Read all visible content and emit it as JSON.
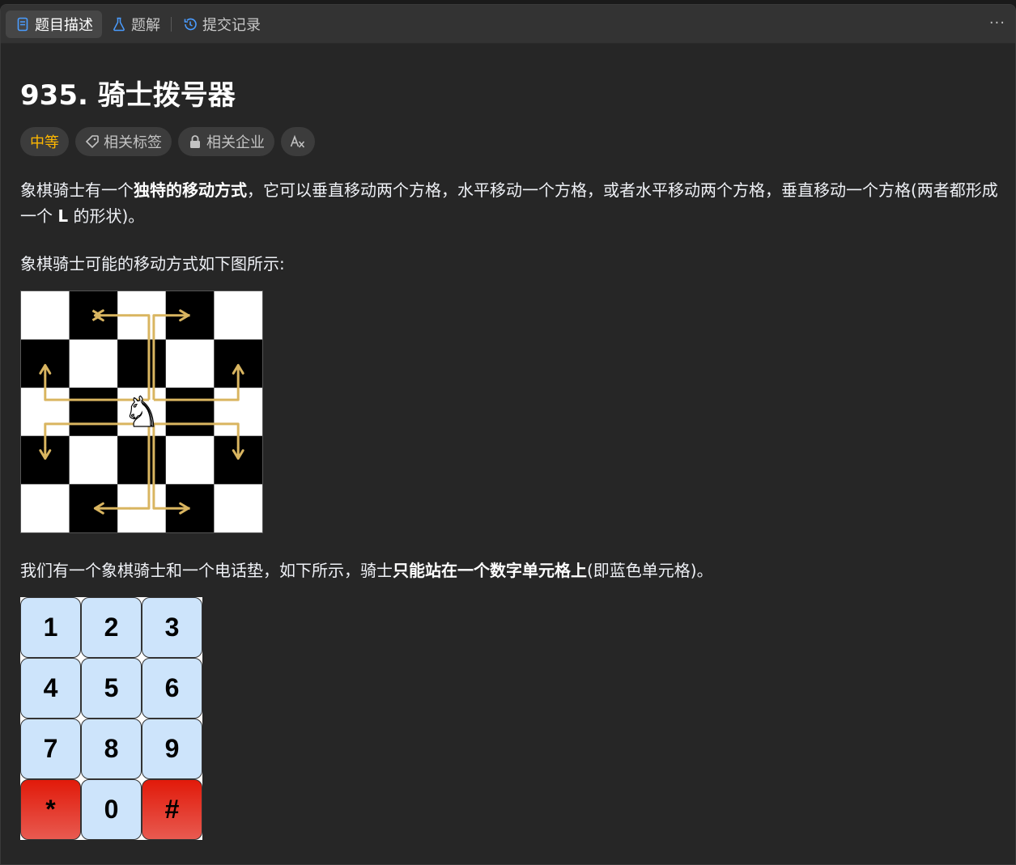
{
  "tabs": [
    {
      "label": "题目描述",
      "icon": "document-icon",
      "active": true
    },
    {
      "label": "题解",
      "icon": "flask-icon",
      "active": false
    },
    {
      "label": "提交记录",
      "icon": "history-icon",
      "active": false
    }
  ],
  "more_label": "···",
  "problem": {
    "title": "935. 骑士拨号器",
    "difficulty": "中等",
    "difficulty_color": "#ffb800",
    "tags": [
      {
        "label": "相关标签",
        "icon": "tag-icon"
      },
      {
        "label": "相关企业",
        "icon": "lock-icon"
      },
      {
        "label": "",
        "icon": "translate-icon"
      }
    ]
  },
  "description": {
    "p1_a": "象棋骑士有一个",
    "p1_b": "独特的移动方式",
    "p1_c": "，它可以垂直移动两个方格，水平移动一个方格，或者水平移动两个方格，垂直移动一个方格(两者都形成一个 ",
    "p1_d": "L",
    "p1_e": " 的形状)。",
    "p2": "象棋骑士可能的移动方式如下图所示:",
    "p3_a": "我们有一个象棋骑士和一个电话垫，如下所示，骑士",
    "p3_b": "只能站在一个数字单元格上",
    "p3_c": "(即蓝色单元格)。"
  },
  "keypad": [
    [
      "1",
      "2",
      "3"
    ],
    [
      "4",
      "5",
      "6"
    ],
    [
      "7",
      "8",
      "9"
    ],
    [
      "*",
      "0",
      "#"
    ]
  ],
  "colors": {
    "key_blue": "#cde4fb",
    "key_red": "#e11a0a",
    "arrow": "#d9b560"
  }
}
